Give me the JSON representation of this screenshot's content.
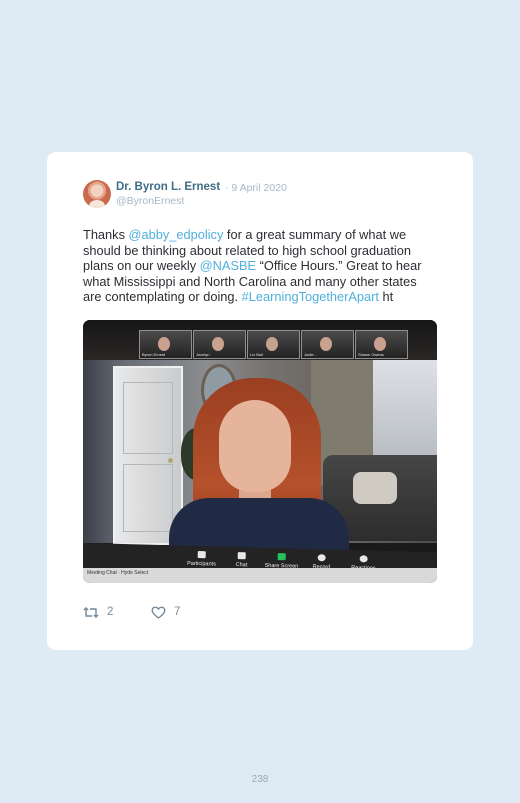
{
  "tweet": {
    "author_name": "Dr. Byron L. Ernest",
    "date": "· 9 April 2020",
    "handle": "@ByronErnest",
    "text": {
      "l1_pre": "Thanks ",
      "mention1": "@abby_edpolicy",
      "l1_post": " for a great summary of what we",
      "l2": "should be thinking about related to high school graduation",
      "l3_pre": "plans on our weekly ",
      "mention2": "@NASBE",
      "l3_post": " “Office Hours.” Great to hear",
      "l4": "what Mississippi and North Carolina and many other states",
      "l5_pre": "are contemplating or doing. ",
      "hashtag": "#LearningTogetherApart",
      "l5_post": " ht"
    },
    "retweets": "2",
    "likes": "7",
    "link_color": "#4fb0dc"
  },
  "media": {
    "participants": [
      "Byron Ernest",
      "Jocelyn",
      "Liz Bull",
      "Jodie...",
      "Shawn Owens"
    ],
    "toolbar": [
      "Participants",
      "Chat",
      "Share Screen",
      "Record",
      "Reactions"
    ],
    "strip_text": "Meeting Chat · Hyde Select"
  },
  "page": {
    "number": "238"
  },
  "icons": [
    "retweet-icon",
    "heart-icon"
  ]
}
